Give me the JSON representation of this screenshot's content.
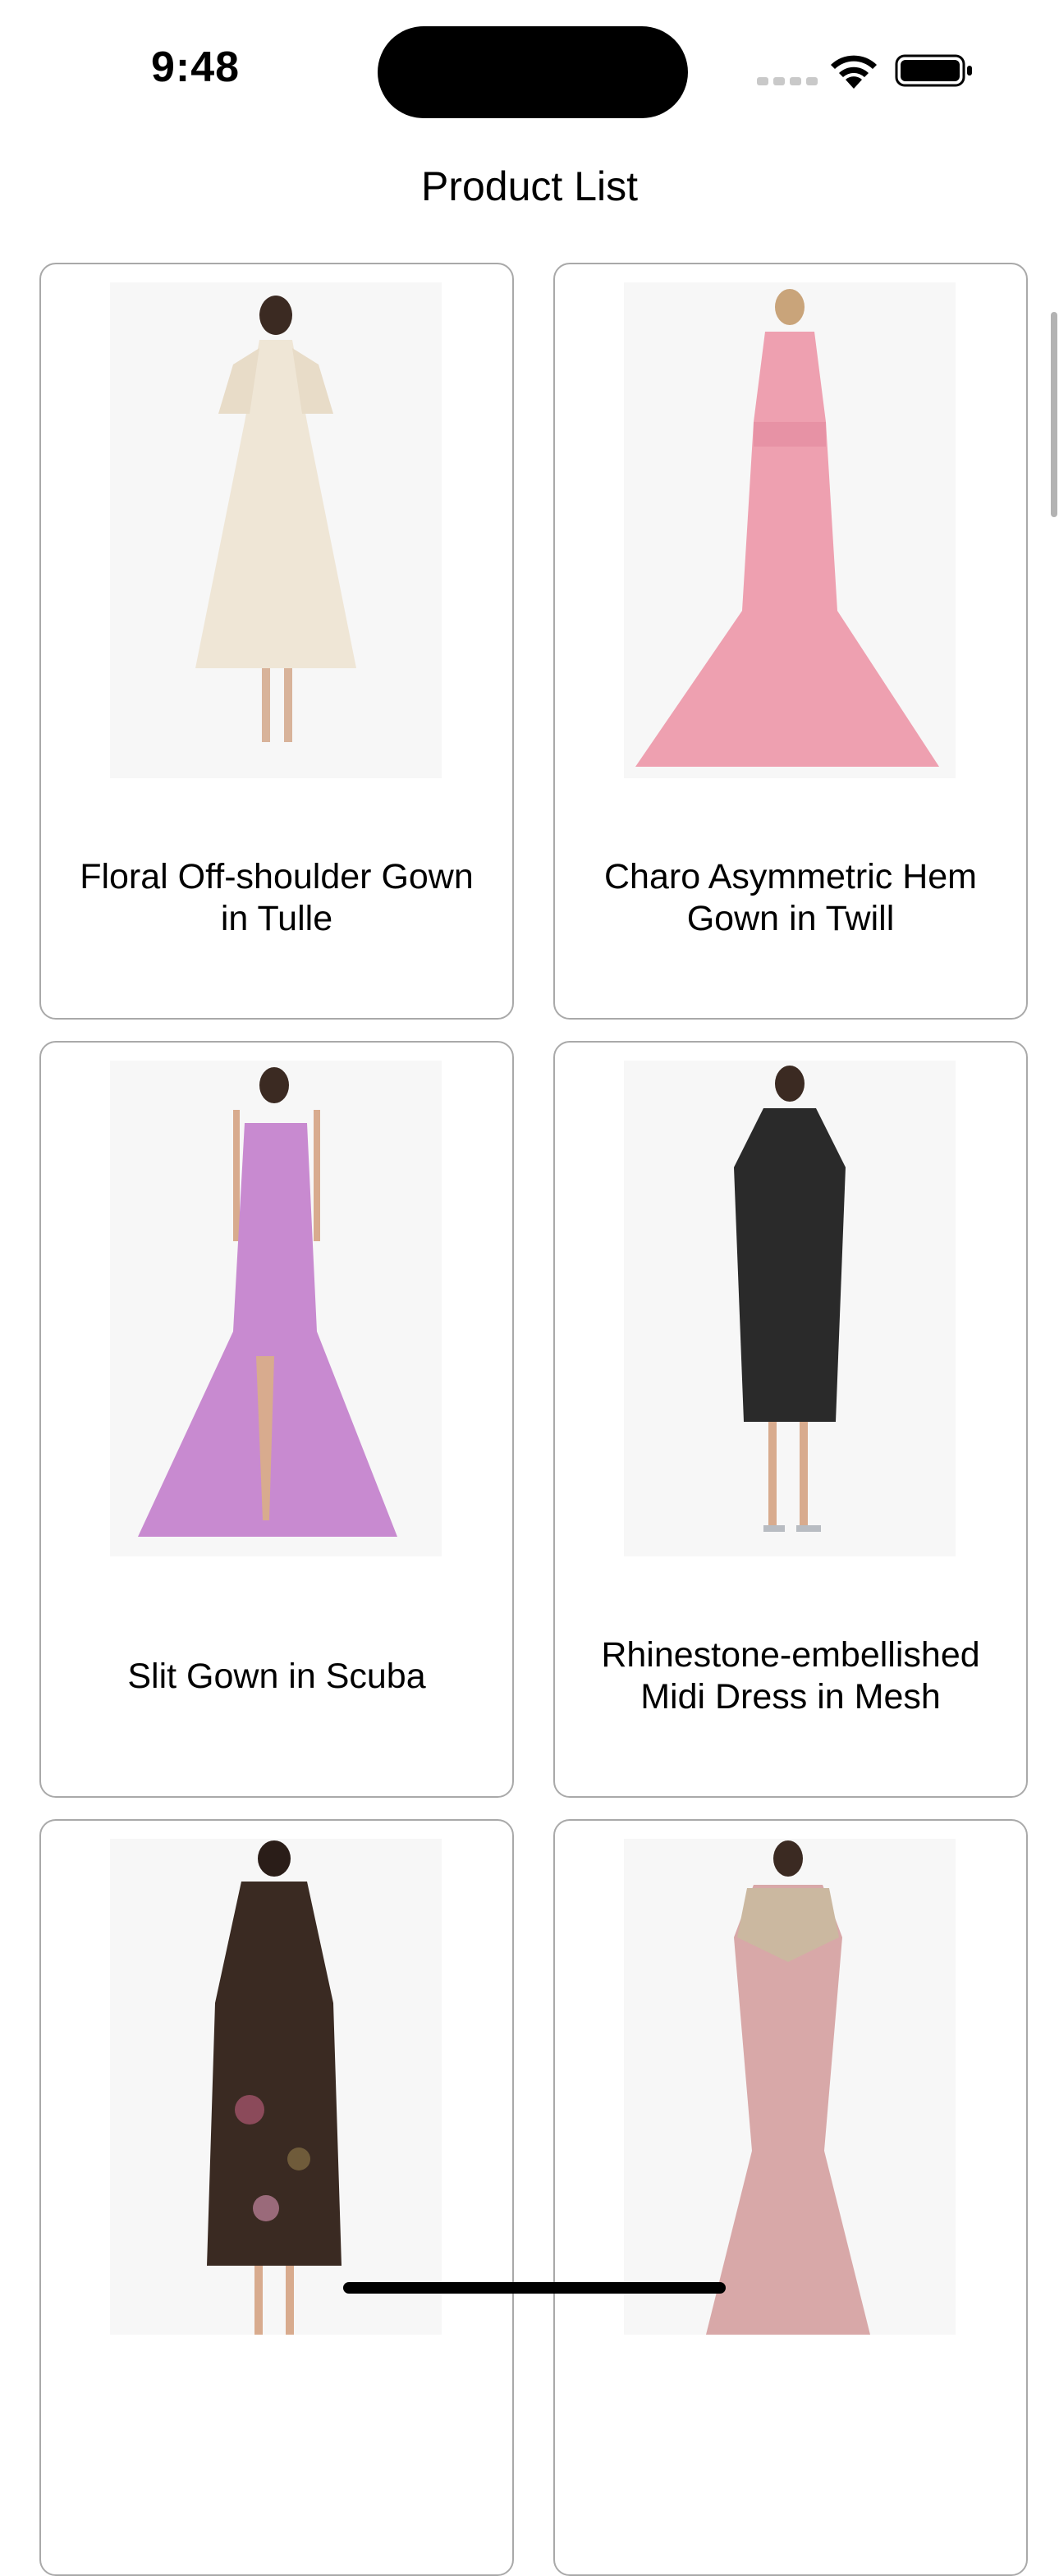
{
  "status_bar": {
    "time": "9:48",
    "icons": [
      "cellular-signal-icon",
      "wifi-icon",
      "battery-icon"
    ]
  },
  "header": {
    "title": "Product List"
  },
  "products": [
    {
      "name": "Floral Off-shoulder Gown in Tulle",
      "image_color": "#efe6d6"
    },
    {
      "name": "Charo Asymmetric Hem Gown in Twill",
      "image_color": "#eea0b0"
    },
    {
      "name": "Slit Gown in Scuba",
      "image_color": "#c88ad0"
    },
    {
      "name": "Rhinestone-embellished Midi Dress in Mesh",
      "image_color": "#2a2a2a"
    },
    {
      "name": "",
      "image_color": "#3a2a22"
    },
    {
      "name": "",
      "image_color": "#d8a8a8"
    }
  ],
  "colors": {
    "card_border": "#a9a9a9",
    "image_background": "#f7f7f7",
    "text": "#000000"
  }
}
